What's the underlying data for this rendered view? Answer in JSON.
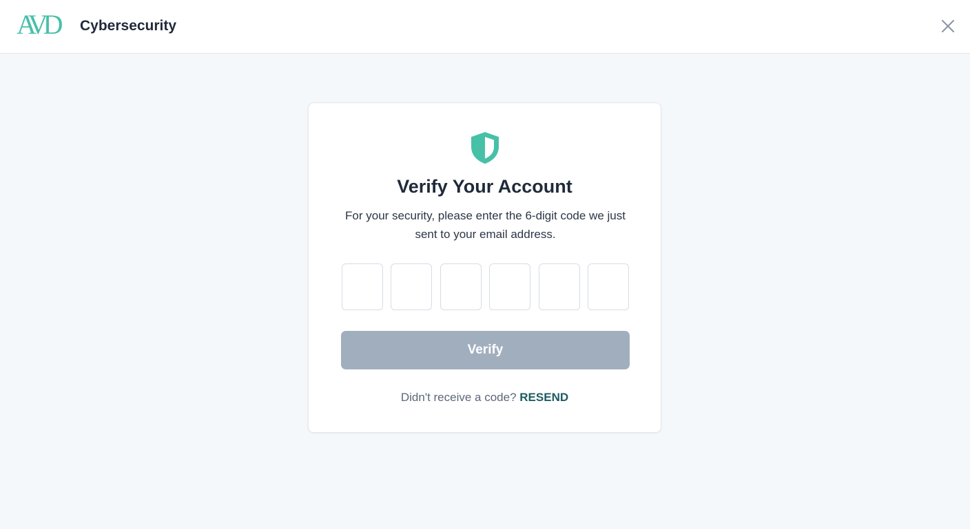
{
  "header": {
    "logo_text": "AVD",
    "brand_name": "Cybersecurity",
    "close_icon": "close-icon"
  },
  "card": {
    "icon": "shield-icon",
    "title": "Verify Your Account",
    "subtitle": "For your security, please enter the 6-digit code we just sent to your email address.",
    "code_inputs": [
      "",
      "",
      "",
      "",
      "",
      ""
    ],
    "verify_label": "Verify",
    "resend_prompt": "Didn't receive a code?",
    "resend_label": "RESEND"
  },
  "colors": {
    "accent": "#47c0a8",
    "button_disabled": "#a1aebe",
    "link": "#1d5c63",
    "background": "#f5f8fb"
  }
}
